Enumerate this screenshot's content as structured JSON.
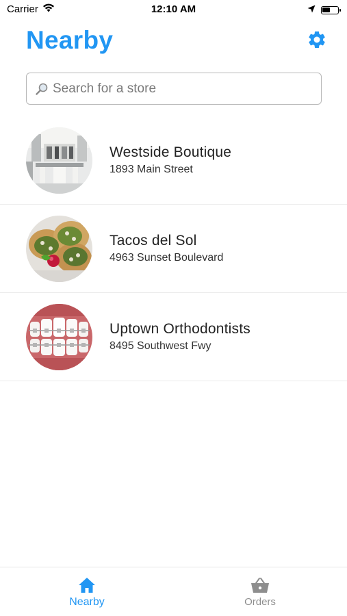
{
  "status_bar": {
    "carrier": "Carrier",
    "time": "12:10 AM"
  },
  "header": {
    "title": "Nearby",
    "settings_icon": "gear-icon"
  },
  "search": {
    "placeholder": "Search for a store",
    "value": ""
  },
  "stores": [
    {
      "name": "Westside Boutique",
      "address": "1893 Main Street",
      "image": "boutique-interior"
    },
    {
      "name": "Tacos del Sol",
      "address": "4963 Sunset Boulevard",
      "image": "tacos-plate"
    },
    {
      "name": "Uptown Orthodontists",
      "address": "8495 Southwest Fwy",
      "image": "teeth-braces"
    }
  ],
  "tab_bar": {
    "tabs": [
      {
        "label": "Nearby",
        "icon": "home-icon",
        "active": true
      },
      {
        "label": "Orders",
        "icon": "basket-icon",
        "active": false
      }
    ]
  },
  "colors": {
    "accent": "#2196f3",
    "inactive_tab": "#8e8e8e"
  }
}
